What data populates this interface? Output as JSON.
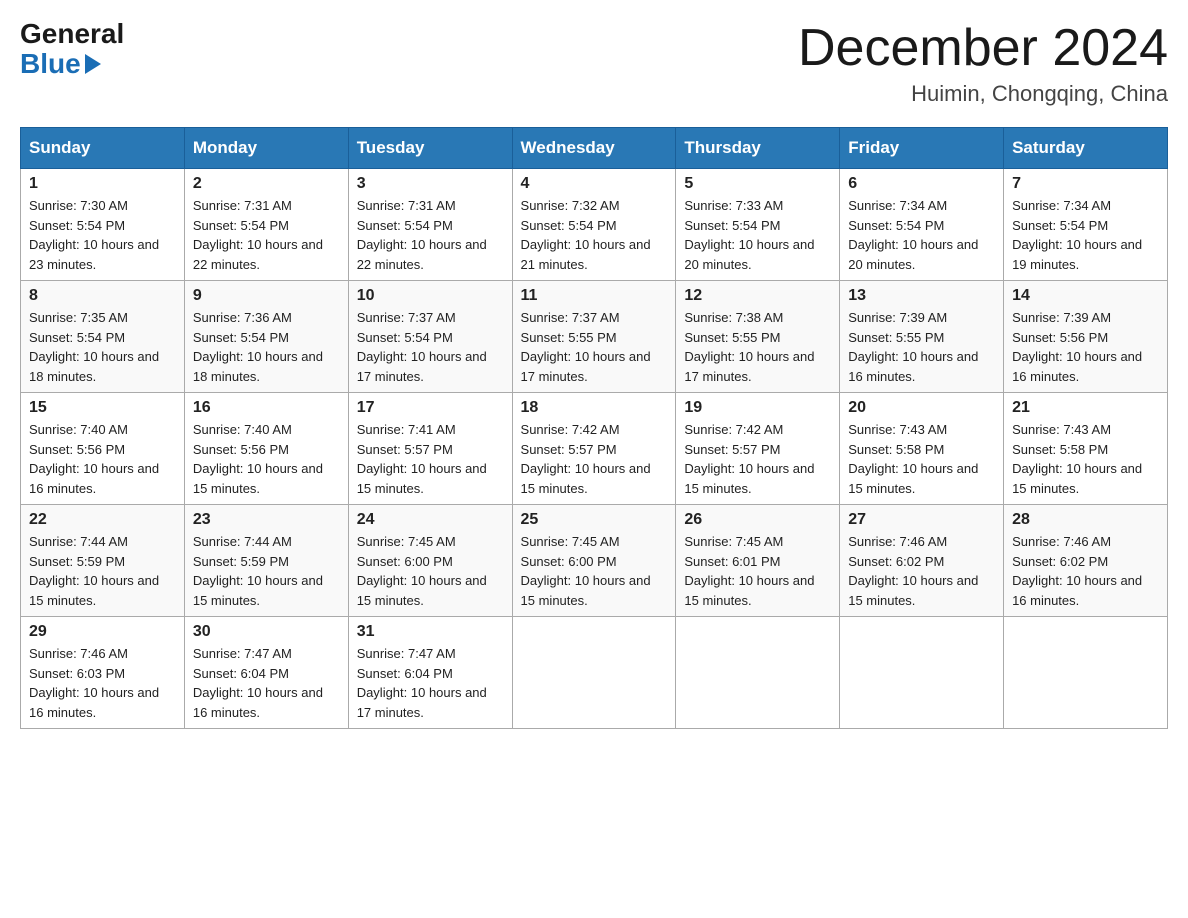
{
  "header": {
    "logo_general": "General",
    "logo_blue": "Blue",
    "month_title": "December 2024",
    "location": "Huimin, Chongqing, China"
  },
  "columns": [
    "Sunday",
    "Monday",
    "Tuesday",
    "Wednesday",
    "Thursday",
    "Friday",
    "Saturday"
  ],
  "weeks": [
    [
      {
        "day": "1",
        "sunrise": "7:30 AM",
        "sunset": "5:54 PM",
        "daylight": "10 hours and 23 minutes."
      },
      {
        "day": "2",
        "sunrise": "7:31 AM",
        "sunset": "5:54 PM",
        "daylight": "10 hours and 22 minutes."
      },
      {
        "day": "3",
        "sunrise": "7:31 AM",
        "sunset": "5:54 PM",
        "daylight": "10 hours and 22 minutes."
      },
      {
        "day": "4",
        "sunrise": "7:32 AM",
        "sunset": "5:54 PM",
        "daylight": "10 hours and 21 minutes."
      },
      {
        "day": "5",
        "sunrise": "7:33 AM",
        "sunset": "5:54 PM",
        "daylight": "10 hours and 20 minutes."
      },
      {
        "day": "6",
        "sunrise": "7:34 AM",
        "sunset": "5:54 PM",
        "daylight": "10 hours and 20 minutes."
      },
      {
        "day": "7",
        "sunrise": "7:34 AM",
        "sunset": "5:54 PM",
        "daylight": "10 hours and 19 minutes."
      }
    ],
    [
      {
        "day": "8",
        "sunrise": "7:35 AM",
        "sunset": "5:54 PM",
        "daylight": "10 hours and 18 minutes."
      },
      {
        "day": "9",
        "sunrise": "7:36 AM",
        "sunset": "5:54 PM",
        "daylight": "10 hours and 18 minutes."
      },
      {
        "day": "10",
        "sunrise": "7:37 AM",
        "sunset": "5:54 PM",
        "daylight": "10 hours and 17 minutes."
      },
      {
        "day": "11",
        "sunrise": "7:37 AM",
        "sunset": "5:55 PM",
        "daylight": "10 hours and 17 minutes."
      },
      {
        "day": "12",
        "sunrise": "7:38 AM",
        "sunset": "5:55 PM",
        "daylight": "10 hours and 17 minutes."
      },
      {
        "day": "13",
        "sunrise": "7:39 AM",
        "sunset": "5:55 PM",
        "daylight": "10 hours and 16 minutes."
      },
      {
        "day": "14",
        "sunrise": "7:39 AM",
        "sunset": "5:56 PM",
        "daylight": "10 hours and 16 minutes."
      }
    ],
    [
      {
        "day": "15",
        "sunrise": "7:40 AM",
        "sunset": "5:56 PM",
        "daylight": "10 hours and 16 minutes."
      },
      {
        "day": "16",
        "sunrise": "7:40 AM",
        "sunset": "5:56 PM",
        "daylight": "10 hours and 15 minutes."
      },
      {
        "day": "17",
        "sunrise": "7:41 AM",
        "sunset": "5:57 PM",
        "daylight": "10 hours and 15 minutes."
      },
      {
        "day": "18",
        "sunrise": "7:42 AM",
        "sunset": "5:57 PM",
        "daylight": "10 hours and 15 minutes."
      },
      {
        "day": "19",
        "sunrise": "7:42 AM",
        "sunset": "5:57 PM",
        "daylight": "10 hours and 15 minutes."
      },
      {
        "day": "20",
        "sunrise": "7:43 AM",
        "sunset": "5:58 PM",
        "daylight": "10 hours and 15 minutes."
      },
      {
        "day": "21",
        "sunrise": "7:43 AM",
        "sunset": "5:58 PM",
        "daylight": "10 hours and 15 minutes."
      }
    ],
    [
      {
        "day": "22",
        "sunrise": "7:44 AM",
        "sunset": "5:59 PM",
        "daylight": "10 hours and 15 minutes."
      },
      {
        "day": "23",
        "sunrise": "7:44 AM",
        "sunset": "5:59 PM",
        "daylight": "10 hours and 15 minutes."
      },
      {
        "day": "24",
        "sunrise": "7:45 AM",
        "sunset": "6:00 PM",
        "daylight": "10 hours and 15 minutes."
      },
      {
        "day": "25",
        "sunrise": "7:45 AM",
        "sunset": "6:00 PM",
        "daylight": "10 hours and 15 minutes."
      },
      {
        "day": "26",
        "sunrise": "7:45 AM",
        "sunset": "6:01 PM",
        "daylight": "10 hours and 15 minutes."
      },
      {
        "day": "27",
        "sunrise": "7:46 AM",
        "sunset": "6:02 PM",
        "daylight": "10 hours and 15 minutes."
      },
      {
        "day": "28",
        "sunrise": "7:46 AM",
        "sunset": "6:02 PM",
        "daylight": "10 hours and 16 minutes."
      }
    ],
    [
      {
        "day": "29",
        "sunrise": "7:46 AM",
        "sunset": "6:03 PM",
        "daylight": "10 hours and 16 minutes."
      },
      {
        "day": "30",
        "sunrise": "7:47 AM",
        "sunset": "6:04 PM",
        "daylight": "10 hours and 16 minutes."
      },
      {
        "day": "31",
        "sunrise": "7:47 AM",
        "sunset": "6:04 PM",
        "daylight": "10 hours and 17 minutes."
      },
      null,
      null,
      null,
      null
    ]
  ]
}
